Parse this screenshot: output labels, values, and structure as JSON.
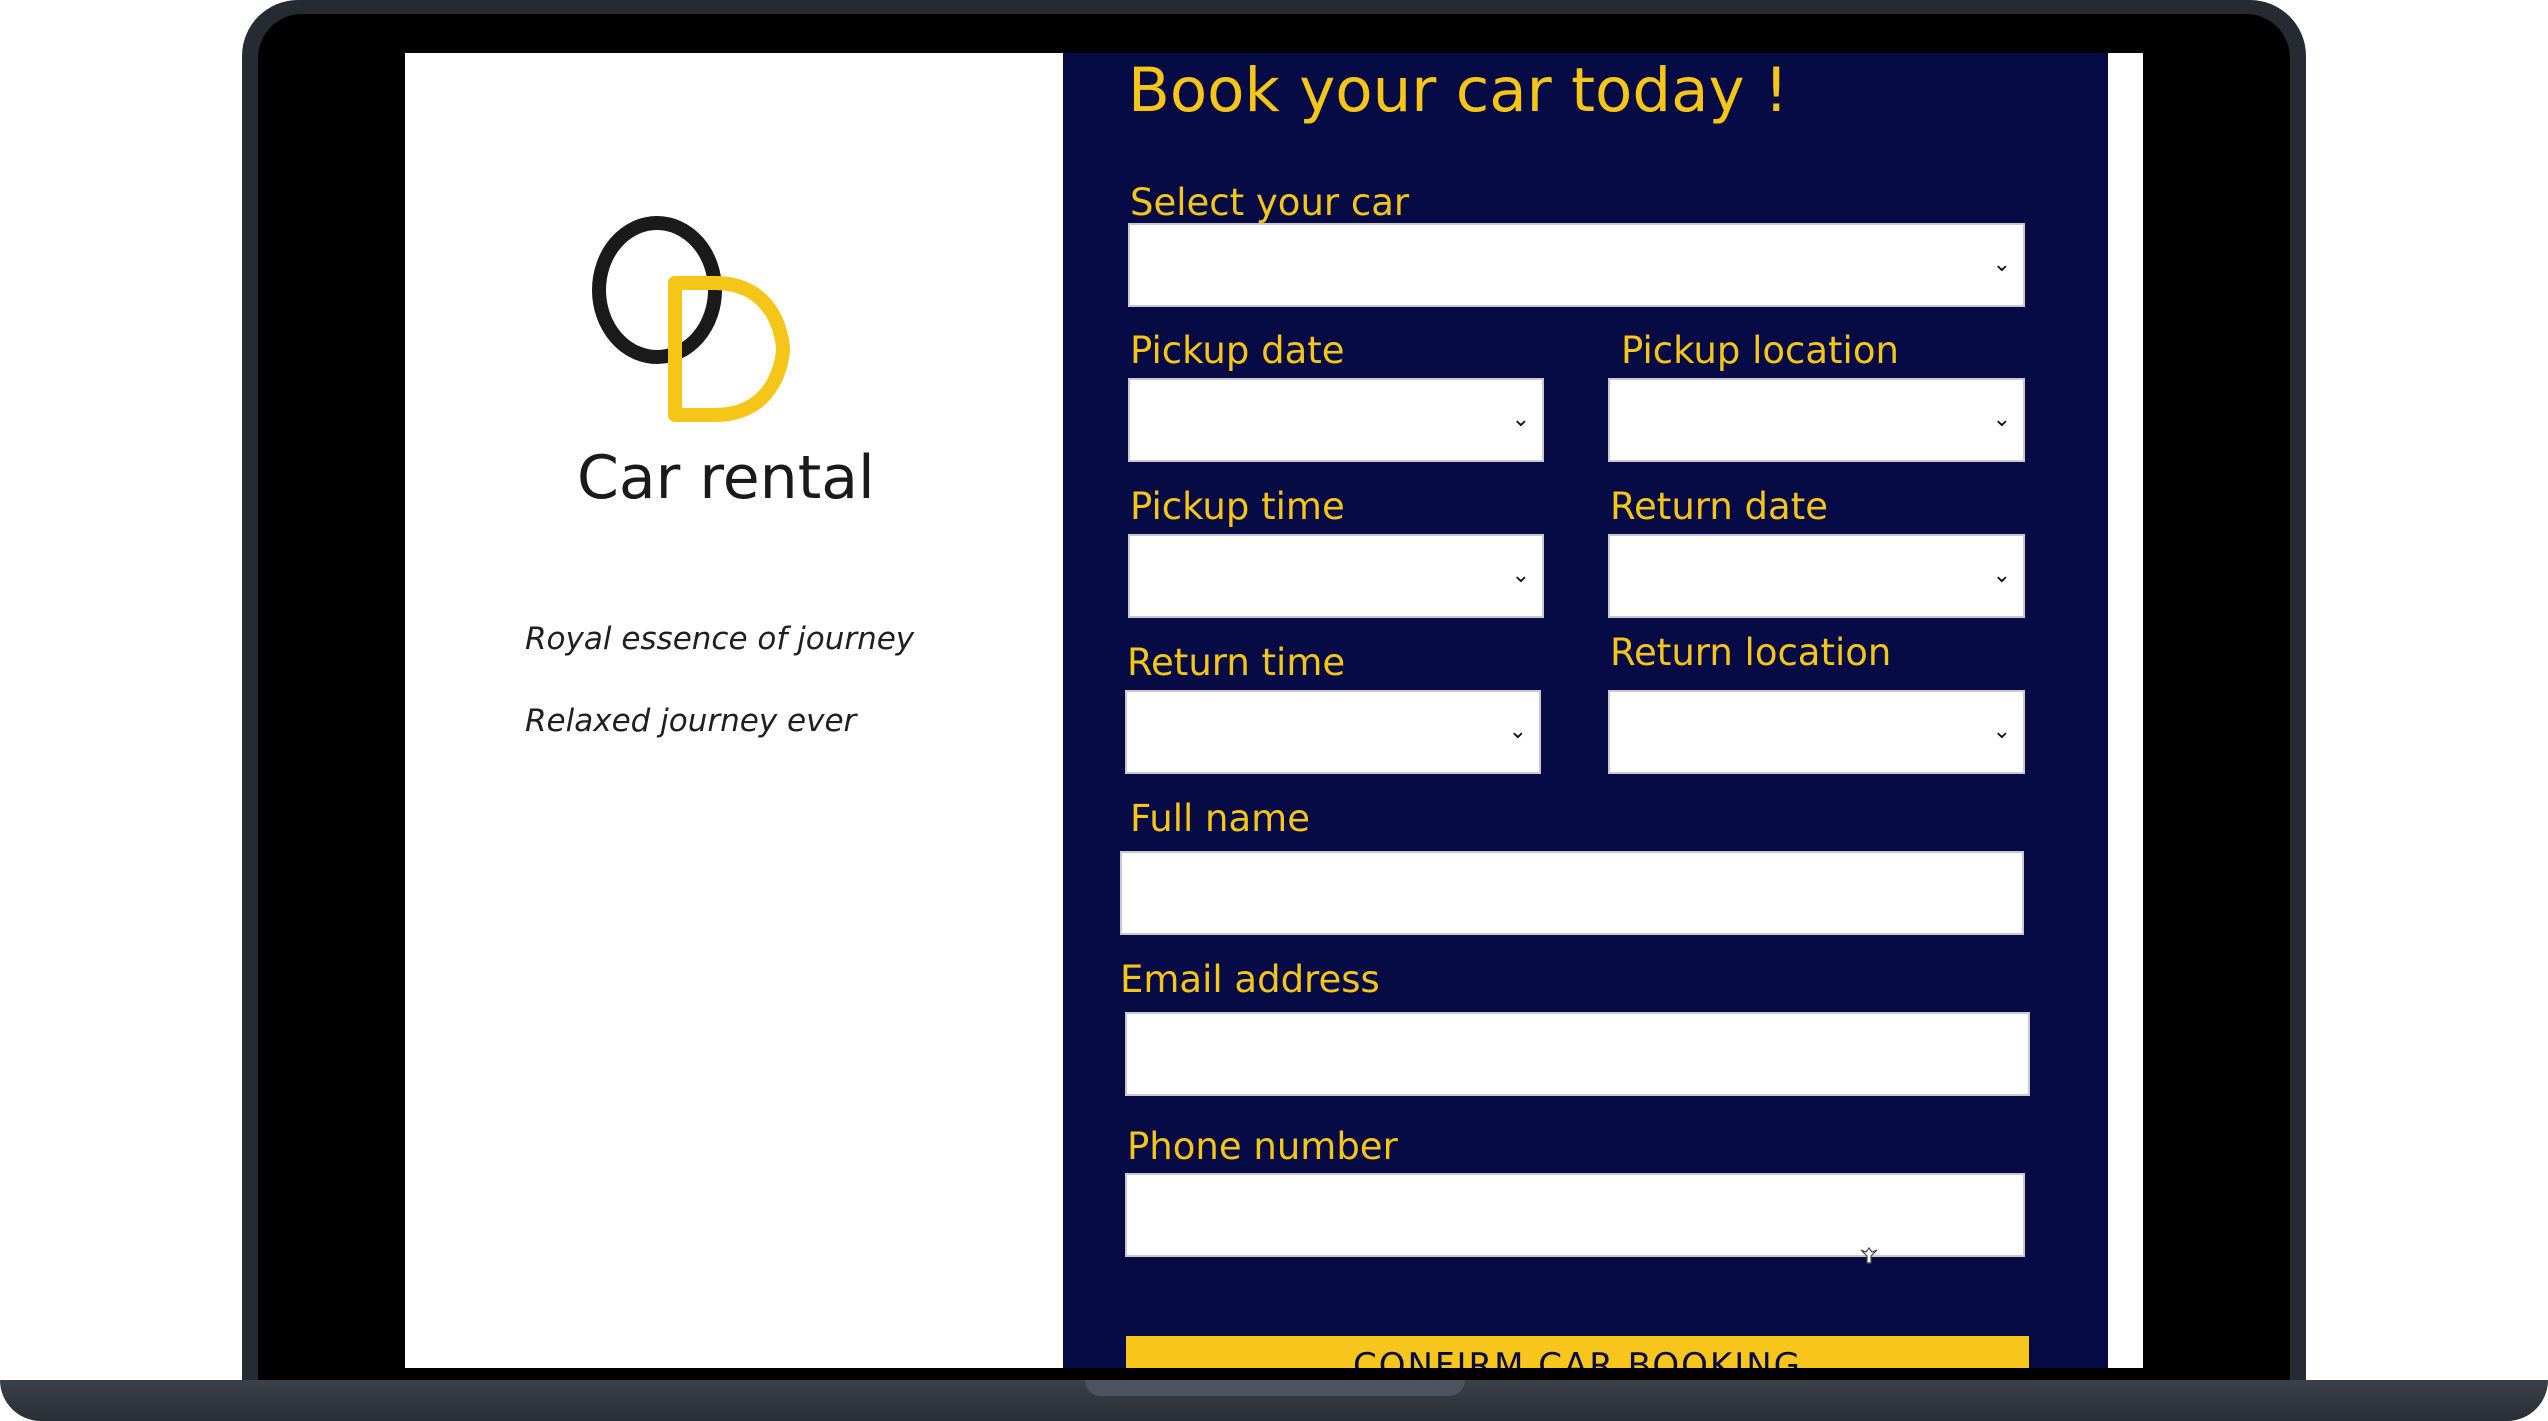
{
  "brand": {
    "logo_letters": "OD",
    "name": "Car rental",
    "taglines": [
      "Royal essence of journey",
      "Relaxed journey ever"
    ]
  },
  "form": {
    "title": "Book your car today !",
    "select_car": {
      "label": "Select your car",
      "value": ""
    },
    "pickup_date": {
      "label": "Pickup date",
      "value": ""
    },
    "pickup_location": {
      "label": "Pickup location",
      "value": ""
    },
    "pickup_time": {
      "label": "Pickup time",
      "value": ""
    },
    "return_date": {
      "label": "Return date",
      "value": ""
    },
    "return_time": {
      "label": "Return time",
      "value": ""
    },
    "return_location": {
      "label": "Return location",
      "value": ""
    },
    "full_name": {
      "label": "Full name",
      "value": ""
    },
    "email": {
      "label": "Email address",
      "value": ""
    },
    "phone": {
      "label": "Phone number",
      "value": ""
    },
    "confirm_label": "CONFIRM CAR BOOKING"
  },
  "colors": {
    "form_background": "#070b45",
    "accent_yellow": "#f5c518",
    "logo_dark": "#1a1a1a"
  },
  "icons": {
    "dropdown": "chevron-down-icon",
    "cursor": "mouse-cursor-icon"
  }
}
